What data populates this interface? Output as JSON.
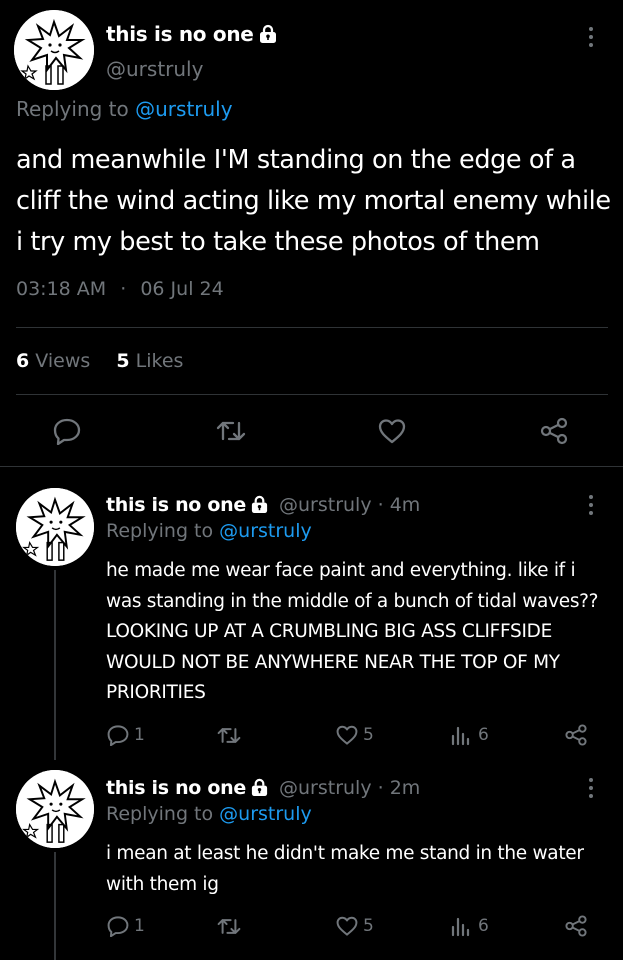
{
  "main_tweet": {
    "display_name": "this is no one",
    "handle": "@urstruly",
    "replying_prefix": "Replying to",
    "replying_handle": "@urstruly",
    "text": "and meanwhile I'M standing on the edge of a cliff the wind acting like my mortal enemy while i try my best to take these photos of them",
    "time": "03:18 AM",
    "separator": "·",
    "date": "06 Jul 24",
    "views_count": "6",
    "views_label": "Views",
    "likes_count": "5",
    "likes_label": "Likes"
  },
  "replies": [
    {
      "display_name": "this is no one",
      "handle": "@urstruly",
      "age": "· 4m",
      "replying_prefix": "Replying to",
      "replying_handle": "@urstruly",
      "text": "he made me wear face paint and everything. like if i was standing in the middle of a bunch of tidal waves?? LOOKING UP AT A CRUMBLING BIG ASS CLIFFSIDE WOULD NOT BE ANYWHERE NEAR THE TOP OF MY PRIORITIES",
      "reply_count": "1",
      "like_count": "5",
      "view_count": "6"
    },
    {
      "display_name": "this is no one",
      "handle": "@urstruly",
      "age": "· 2m",
      "replying_prefix": "Replying to",
      "replying_handle": "@urstruly",
      "text": "i mean at least he didn't make me stand in the water with them ig",
      "reply_count": "1",
      "like_count": "5",
      "view_count": "6"
    }
  ],
  "icons": [
    "lock-icon",
    "more-options-icon",
    "reply-icon",
    "retweet-icon",
    "like-icon",
    "share-icon",
    "views-icon"
  ],
  "colors": {
    "background": "#000000",
    "accent": "#1d9bf0",
    "muted": "#71767b",
    "text": "#e7e9ea"
  }
}
